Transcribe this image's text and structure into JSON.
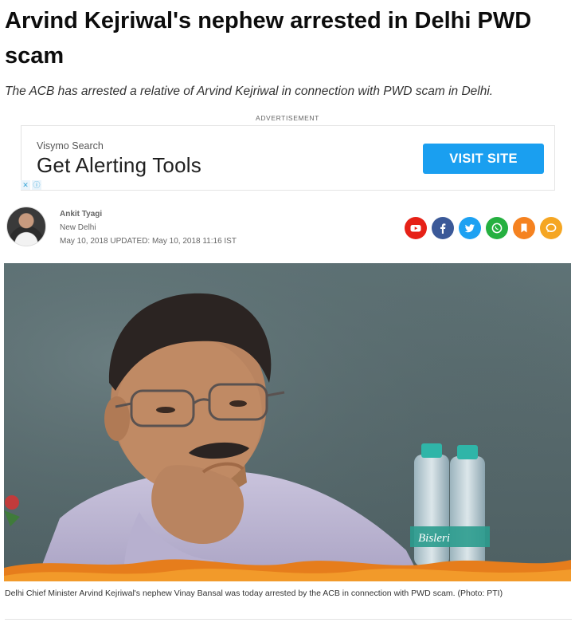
{
  "article": {
    "headline": "Arvind Kejriwal's nephew arrested in Delhi PWD scam",
    "summary": "The ACB has arrested a relative of Arvind Kejriwal in connection with PWD scam in Delhi."
  },
  "advertisement": {
    "label": "ADVERTISEMENT",
    "brand": "Visymo Search",
    "headline": "Get Alerting Tools",
    "button_label": "VISIT SITE"
  },
  "byline": {
    "author": "Ankit Tyagi",
    "location": "New Delhi",
    "dateline": "May 10, 2018 UPDATED: May 10, 2018 11:16 IST"
  },
  "share": [
    {
      "icon": "youtube-icon",
      "color": "#e62117"
    },
    {
      "icon": "facebook-icon",
      "color": "#3b5998"
    },
    {
      "icon": "twitter-icon",
      "color": "#1da1f2"
    },
    {
      "icon": "whatsapp-icon",
      "color": "#25b040"
    },
    {
      "icon": "bookmark-icon",
      "color": "#f58220"
    },
    {
      "icon": "comment-icon",
      "color": "#f5a623"
    }
  ],
  "photo": {
    "caption": "Delhi Chief Minister Arvind Kejriwal's nephew Vinay Bansal was today arrested by the ACB in connection with PWD scam. (Photo: PTI)",
    "bottle_label": "Bisleri"
  }
}
